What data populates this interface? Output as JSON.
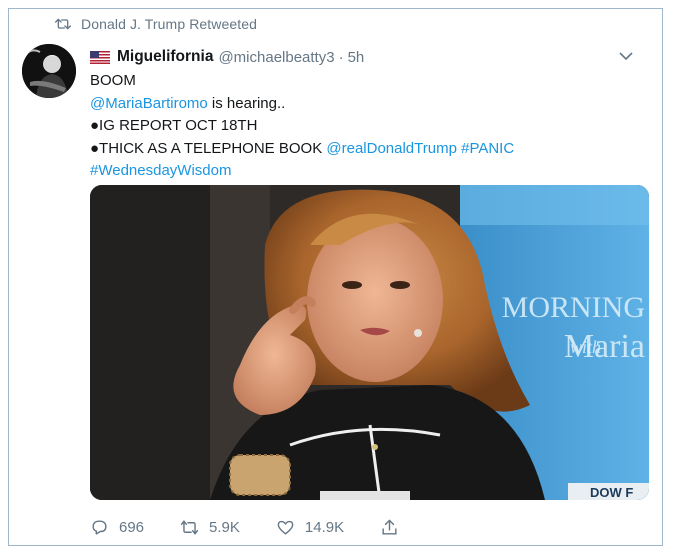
{
  "retweet_context": {
    "text": "Donald J. Trump Retweeted"
  },
  "author": {
    "display_name": "Miguelifornia",
    "handle": "@michaelbeatty3",
    "separator": "·",
    "time": "5h"
  },
  "tweet": {
    "line1": "BOOM",
    "line2_mention": "@MariaBartiromo",
    "line2_text": " is hearing..",
    "line3": "●IG REPORT OCT 18TH",
    "line4_text": "●THICK AS A TELEPHONE BOOK ",
    "line4_mention": "@realDonaldTrump",
    "line4_space": " ",
    "line4_hashtag": "#PANIC",
    "line5_hashtag": "#WednesdayWisdom"
  },
  "media": {
    "overlay_text_1": "MORNING",
    "overlay_text_2": "Maria",
    "overlay_text_2_prefix": "with",
    "ticker_text": "DOW F"
  },
  "actions": {
    "replies": "696",
    "retweets": "5.9K",
    "likes": "14.9K"
  },
  "colors": {
    "link": "#1b95e0",
    "secondary_text": "#657786",
    "frame_border": "#9fb6cc"
  },
  "icons": [
    "retweet-icon",
    "us-flag-icon",
    "chevron-down-icon",
    "reply-icon",
    "retweet-action-icon",
    "like-icon",
    "share-icon"
  ]
}
